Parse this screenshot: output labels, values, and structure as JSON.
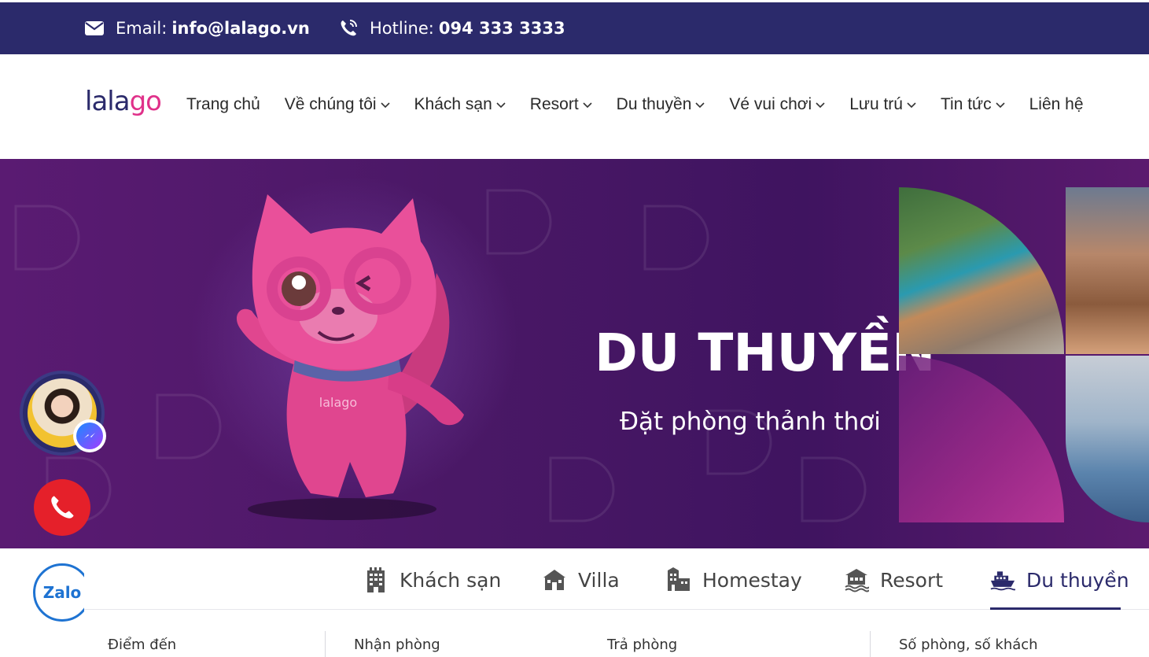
{
  "topbar": {
    "email_label": "Email:",
    "email_value": "info@lalago.vn",
    "hotline_label": "Hotline:",
    "hotline_value": "094 333 3333",
    "bg_color": "#2b2a6b"
  },
  "logo": {
    "part1": "lala",
    "part2": "go"
  },
  "nav": [
    {
      "label": "Trang chủ",
      "has_dropdown": false
    },
    {
      "label": "Về chúng tôi",
      "has_dropdown": true
    },
    {
      "label": "Khách sạn",
      "has_dropdown": true
    },
    {
      "label": "Resort",
      "has_dropdown": true
    },
    {
      "label": "Du thuyền",
      "has_dropdown": true
    },
    {
      "label": "Vé vui chơi",
      "has_dropdown": true
    },
    {
      "label": "Lưu trú",
      "has_dropdown": true
    },
    {
      "label": "Tin tức",
      "has_dropdown": true
    },
    {
      "label": "Liên hệ",
      "has_dropdown": false
    }
  ],
  "hero": {
    "title": "DU THUYỀN",
    "subtitle": "Đặt phòng thảnh thơi",
    "mascot_text": "lalago"
  },
  "floating": {
    "zalo_label": "Zalo"
  },
  "search": {
    "tabs": [
      {
        "label": "Khách sạn",
        "icon": "building-icon"
      },
      {
        "label": "Villa",
        "icon": "villa-icon"
      },
      {
        "label": "Homestay",
        "icon": "homestay-icon"
      },
      {
        "label": "Resort",
        "icon": "resort-icon"
      },
      {
        "label": "Du thuyền",
        "icon": "cruise-ship-icon",
        "active": true
      }
    ],
    "fields": {
      "destination": "Điểm đến",
      "checkin": "Nhận phòng",
      "checkout": "Trả phòng",
      "rooms_guests": "Số phòng, số khách"
    }
  },
  "colors": {
    "primary": "#2b2a6b",
    "accent": "#e0318a",
    "call": "#e5202a",
    "zalo": "#1e73d2"
  }
}
